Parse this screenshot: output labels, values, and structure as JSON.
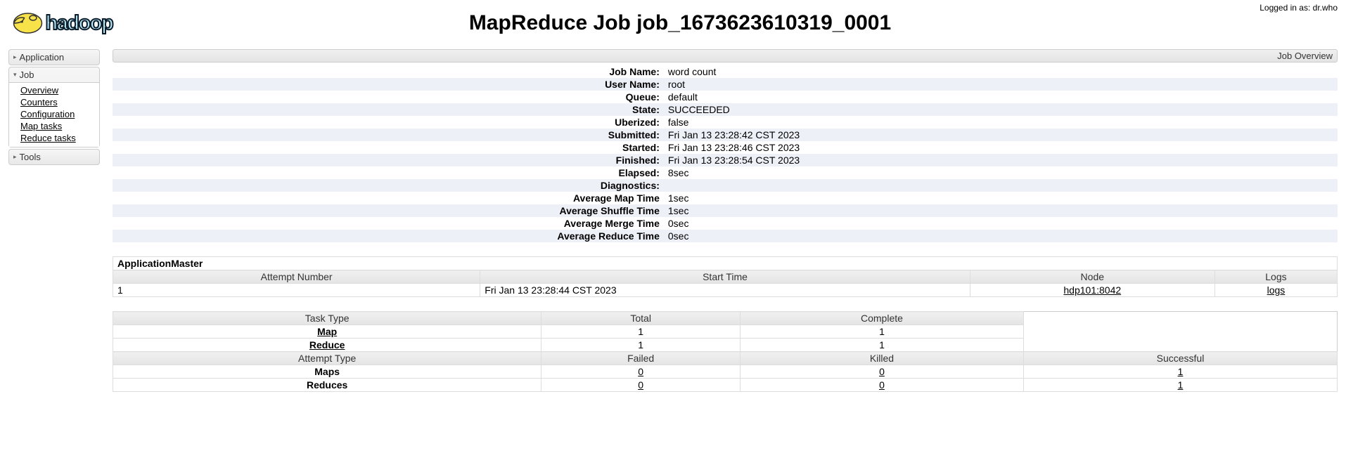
{
  "login_prefix": "Logged in as: ",
  "login_user": "dr.who",
  "page_title": "MapReduce Job job_1673623610319_0001",
  "sidebar": {
    "application": "Application",
    "job": "Job",
    "job_items": [
      "Overview",
      "Counters",
      "Configuration",
      "Map tasks",
      "Reduce tasks"
    ],
    "tools": "Tools"
  },
  "overview_label": "Job Overview",
  "kv": [
    {
      "k": "Job Name:",
      "v": "word count"
    },
    {
      "k": "User Name:",
      "v": "root"
    },
    {
      "k": "Queue:",
      "v": "default"
    },
    {
      "k": "State:",
      "v": "SUCCEEDED"
    },
    {
      "k": "Uberized:",
      "v": "false"
    },
    {
      "k": "Submitted:",
      "v": "Fri Jan 13 23:28:42 CST 2023"
    },
    {
      "k": "Started:",
      "v": "Fri Jan 13 23:28:46 CST 2023"
    },
    {
      "k": "Finished:",
      "v": "Fri Jan 13 23:28:54 CST 2023"
    },
    {
      "k": "Elapsed:",
      "v": "8sec"
    },
    {
      "k": "Diagnostics:",
      "v": ""
    },
    {
      "k": "Average Map Time",
      "v": "1sec"
    },
    {
      "k": "Average Shuffle Time",
      "v": "1sec"
    },
    {
      "k": "Average Merge Time",
      "v": "0sec"
    },
    {
      "k": "Average Reduce Time",
      "v": "0sec"
    }
  ],
  "appmaster": {
    "section": "ApplicationMaster",
    "headers": [
      "Attempt Number",
      "Start Time",
      "Node",
      "Logs"
    ],
    "row": {
      "attempt": "1",
      "start": "Fri Jan 13 23:28:44 CST 2023",
      "node": "hdp101:8042",
      "logs": "logs"
    }
  },
  "tasks": {
    "headers": [
      "Task Type",
      "Total",
      "Complete"
    ],
    "rows": [
      {
        "type": "Map",
        "total": "1",
        "complete": "1"
      },
      {
        "type": "Reduce",
        "total": "1",
        "complete": "1"
      }
    ]
  },
  "attempts": {
    "headers": [
      "Attempt Type",
      "Failed",
      "Killed",
      "Successful"
    ],
    "rows": [
      {
        "type": "Maps",
        "failed": "0",
        "killed": "0",
        "successful": "1"
      },
      {
        "type": "Reduces",
        "failed": "0",
        "killed": "0",
        "successful": "1"
      }
    ]
  }
}
